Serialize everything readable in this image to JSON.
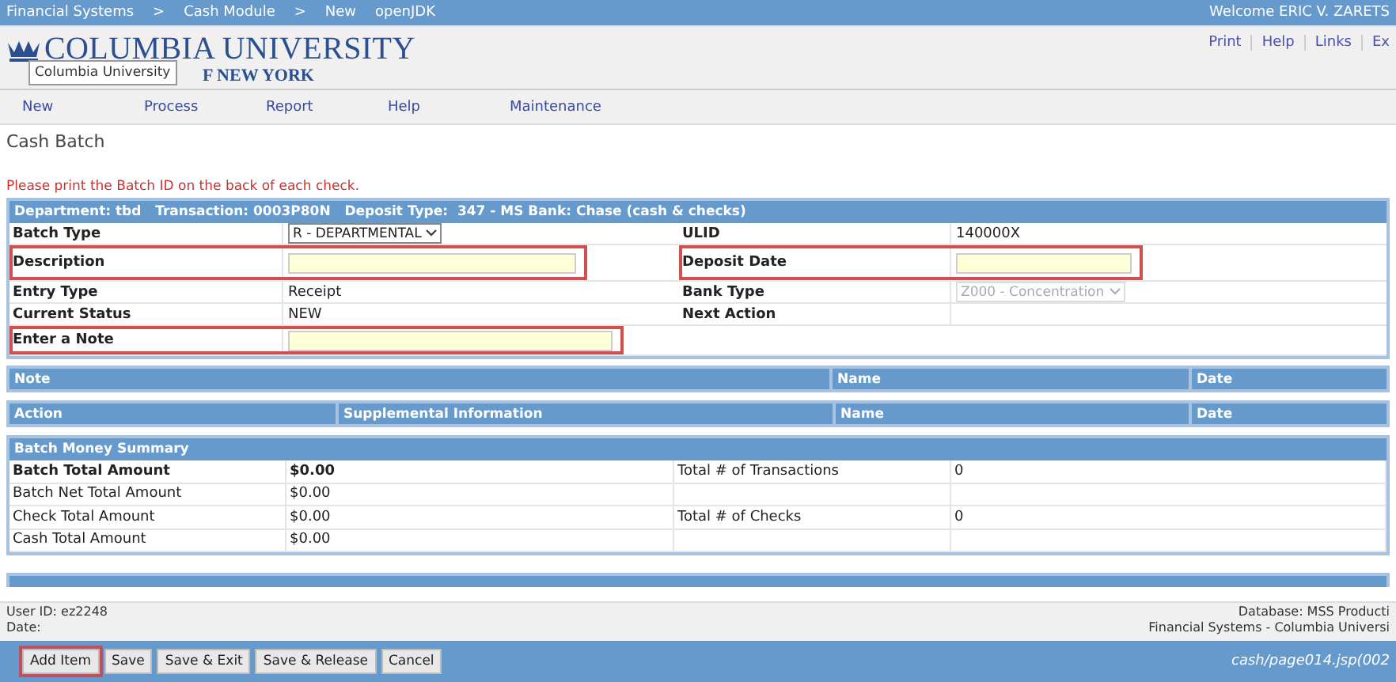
{
  "top_bar": {
    "breadcrumb": [
      "Financial Systems",
      ">",
      "Cash Module",
      ">",
      "New",
      "openJDK"
    ],
    "welcome": "Welcome ERIC V. ZARETS"
  },
  "header": {
    "logo_line1": "COLUMBIA UNIVERSITY",
    "logo_line2": "F NEW YORK",
    "tooltip": "Columbia University",
    "links": [
      "Print",
      "Help",
      "Links",
      "Ex"
    ]
  },
  "menu": [
    "New",
    "Process",
    "Report",
    "Help",
    "Maintenance"
  ],
  "page_title": "Cash Batch",
  "notice": "Please print the Batch ID on the back of each check.",
  "batch_form": {
    "header": "Department: tbd   Transaction: 0003P80N   Deposit Type:  347 - MS Bank: Chase (cash & checks)",
    "rows": [
      [
        {
          "label": "Batch Type",
          "kind": "select",
          "value": "R - DEPARTMENTAL",
          "highlighted": false,
          "disabled": false
        },
        {
          "label": "ULID",
          "kind": "text",
          "value": "140000X",
          "highlighted": false
        }
      ],
      [
        {
          "label": "Description",
          "kind": "input",
          "highlighted": true
        },
        {
          "label": "Deposit Date",
          "kind": "input",
          "highlighted": true
        }
      ],
      [
        {
          "label": "Entry Type",
          "kind": "text",
          "value": "Receipt",
          "highlighted": false
        },
        {
          "label": "Bank Type",
          "kind": "select",
          "value": "Z000 - Concentration",
          "highlighted": false,
          "disabled": true
        }
      ],
      [
        {
          "label": "Current Status",
          "kind": "text",
          "value": "NEW",
          "highlighted": false
        },
        {
          "label": "Next Action",
          "kind": "text",
          "highlighted": false
        }
      ],
      [
        {
          "label": "Enter a Note",
          "kind": "input",
          "highlighted": true
        },
        {
          "kind": "empty",
          "highlighted": false
        }
      ]
    ]
  },
  "notes_table": {
    "columns": [
      "Note",
      "Name",
      "Date"
    ]
  },
  "actions_table": {
    "columns": [
      "Action",
      "Supplemental Information",
      "Name",
      "Date"
    ]
  },
  "money_summary": {
    "title": "Batch Money Summary",
    "rows": [
      {
        "label": "Batch Total Amount",
        "value": "$0.00",
        "label_2": "Total # of Transactions",
        "value_2": "0",
        "bold": true
      },
      {
        "label": "Batch Net Total Amount",
        "value": "$0.00",
        "bold": false
      },
      {
        "label": "Check Total Amount",
        "value": "$0.00",
        "label_2": "Total # of Checks",
        "value_2": "0",
        "bold": false
      },
      {
        "label": "Cash Total Amount",
        "value": "$0.00",
        "bold": false
      }
    ]
  },
  "footer": {
    "user_id": "User ID: ez2248",
    "date": "Date:",
    "database": "Database: MSS Producti",
    "system": "Financial Systems - Columbia Universi"
  },
  "buttons": [
    {
      "label": "Add Item",
      "highlighted": true
    },
    {
      "label": "Save",
      "highlighted": false
    },
    {
      "label": "Save & Exit",
      "highlighted": false
    },
    {
      "label": "Save & Release",
      "highlighted": false
    },
    {
      "label": "Cancel",
      "highlighted": false
    }
  ],
  "page_path": "cash/page014.jsp(002"
}
